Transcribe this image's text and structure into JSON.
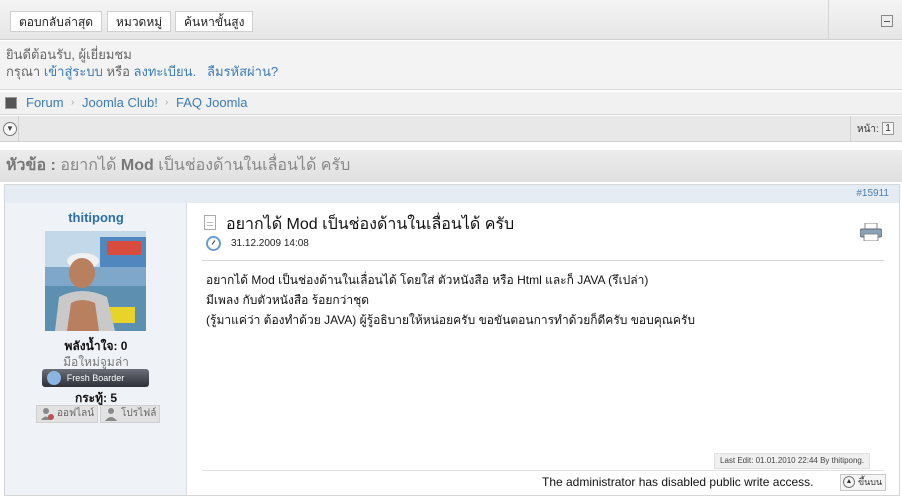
{
  "toolbar": {
    "latest_replies": "ตอบกลับล่าสุด",
    "categories": "หมวดหมู่",
    "advanced_search": "ค้นหาขั้นสูง"
  },
  "welcome": {
    "greeting": "ยินดีต้อนรับ, ผู้เยี่ยมชม",
    "please": "กรุณา",
    "login": "เข้าสู่ระบบ",
    "or": "หรือ",
    "register": "ลงทะเบียน.",
    "forgot": "ลืมรหัสผ่าน?"
  },
  "breadcrumb": [
    "Forum",
    "Joomla Club!",
    "FAQ Joomla"
  ],
  "pagination": {
    "label": "หน้า:",
    "current": "1"
  },
  "topic": {
    "prefix": "หัวข้อ :",
    "pre": "อยากได้",
    "bold": "Mod",
    "post": "เป็นช่องด้านในเลื่อนได้ ครับ"
  },
  "post": {
    "id": "#15911",
    "author": {
      "name": "thitipong",
      "karma": "พลังน้ำใจ: 0",
      "rank_title": "มือใหม่จูมล่า",
      "rank_badge": "Fresh Boarder",
      "posts_label": "กระทู้:",
      "posts_count": "5",
      "offline": "ออฟไลน์",
      "profile": "โปรไฟล์"
    },
    "subject": "อยากได้ Mod เป็นช่องด้านในเลื่อนได้ ครับ",
    "date": "31.12.2009 14:08",
    "body": [
      "อยากได้ Mod เป็นช่องด้านในเลื่อนได้ โดยใส่ ตัวหนังสือ หรือ Html และก็ JAVA (รึเปล่า)",
      "มีเพลง กับตัวหนังสือ ร้อยกว่าชุด",
      "(รู้มาแค่ว่า ต้องทำด้วย JAVA) ผู้รู้อธิบายให้หน่อยครับ ขอขันตอนการทำด้วยก็ดีครับ ขอบคุณครับ"
    ],
    "last_edit": "Last Edit: 01.01.2010 22:44 By thitipong.",
    "write_disabled": "The administrator has disabled public write access.",
    "top_button": "ขึ้นบน"
  }
}
